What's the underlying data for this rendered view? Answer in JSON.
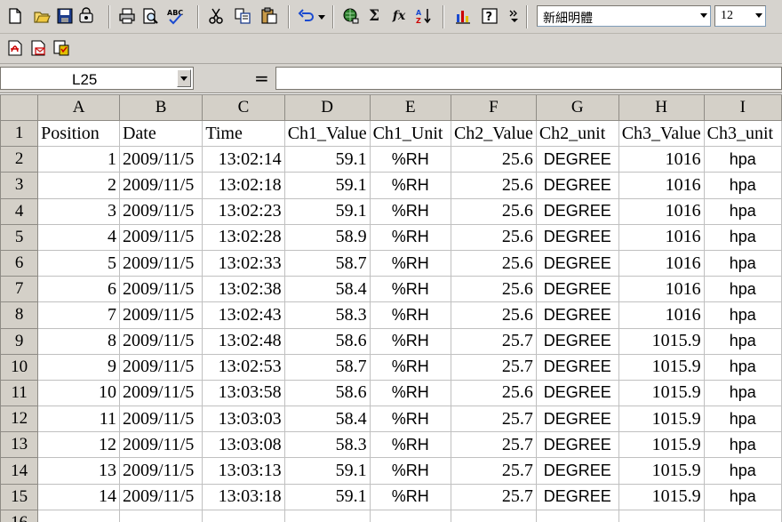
{
  "toolbar": {
    "font_name": "新細明體",
    "font_size": "12",
    "icons": [
      "new-icon",
      "open-icon",
      "save-icon",
      "permission-icon",
      "print-icon",
      "print-preview-icon",
      "spelling-icon",
      "cut-icon",
      "copy-icon",
      "paste-icon",
      "undo-icon",
      "hyperlink-icon",
      "autosum-icon",
      "function-icon",
      "sort-ascending-icon",
      "chart-wizard-icon",
      "help-icon",
      "more-icon"
    ],
    "glyphs": {
      "autosum": "Σ",
      "function": "fx"
    }
  },
  "toolbar2": {
    "icons": [
      "convert-to-pdf-icon",
      "convert-and-email-icon",
      "pdf-review-icon"
    ]
  },
  "formula_bar": {
    "name_box": "L25",
    "equals": "=",
    "formula": ""
  },
  "sheet": {
    "column_headers": [
      "A",
      "B",
      "C",
      "D",
      "E",
      "F",
      "G",
      "H",
      "I"
    ],
    "rows": [
      {
        "n": "1",
        "cells": [
          "Position",
          "Date",
          "Time",
          "Ch1_Value",
          "Ch1_Unit",
          "Ch2_Value",
          "Ch2_unit",
          "Ch3_Value",
          "Ch3_unit"
        ]
      },
      {
        "n": "2",
        "cells": [
          "1",
          "2009/11/5",
          "13:02:14",
          "59.1",
          "%RH",
          "25.6",
          "DEGREE",
          "1016",
          "hpa"
        ]
      },
      {
        "n": "3",
        "cells": [
          "2",
          "2009/11/5",
          "13:02:18",
          "59.1",
          "%RH",
          "25.6",
          "DEGREE",
          "1016",
          "hpa"
        ]
      },
      {
        "n": "4",
        "cells": [
          "3",
          "2009/11/5",
          "13:02:23",
          "59.1",
          "%RH",
          "25.6",
          "DEGREE",
          "1016",
          "hpa"
        ]
      },
      {
        "n": "5",
        "cells": [
          "4",
          "2009/11/5",
          "13:02:28",
          "58.9",
          "%RH",
          "25.6",
          "DEGREE",
          "1016",
          "hpa"
        ]
      },
      {
        "n": "6",
        "cells": [
          "5",
          "2009/11/5",
          "13:02:33",
          "58.7",
          "%RH",
          "25.6",
          "DEGREE",
          "1016",
          "hpa"
        ]
      },
      {
        "n": "7",
        "cells": [
          "6",
          "2009/11/5",
          "13:02:38",
          "58.4",
          "%RH",
          "25.6",
          "DEGREE",
          "1016",
          "hpa"
        ]
      },
      {
        "n": "8",
        "cells": [
          "7",
          "2009/11/5",
          "13:02:43",
          "58.3",
          "%RH",
          "25.6",
          "DEGREE",
          "1016",
          "hpa"
        ]
      },
      {
        "n": "9",
        "cells": [
          "8",
          "2009/11/5",
          "13:02:48",
          "58.6",
          "%RH",
          "25.7",
          "DEGREE",
          "1015.9",
          "hpa"
        ]
      },
      {
        "n": "10",
        "cells": [
          "9",
          "2009/11/5",
          "13:02:53",
          "58.7",
          "%RH",
          "25.7",
          "DEGREE",
          "1015.9",
          "hpa"
        ]
      },
      {
        "n": "11",
        "cells": [
          "10",
          "2009/11/5",
          "13:03:58",
          "58.6",
          "%RH",
          "25.6",
          "DEGREE",
          "1015.9",
          "hpa"
        ]
      },
      {
        "n": "12",
        "cells": [
          "11",
          "2009/11/5",
          "13:03:03",
          "58.4",
          "%RH",
          "25.7",
          "DEGREE",
          "1015.9",
          "hpa"
        ]
      },
      {
        "n": "13",
        "cells": [
          "12",
          "2009/11/5",
          "13:03:08",
          "58.3",
          "%RH",
          "25.7",
          "DEGREE",
          "1015.9",
          "hpa"
        ]
      },
      {
        "n": "14",
        "cells": [
          "13",
          "2009/11/5",
          "13:03:13",
          "59.1",
          "%RH",
          "25.7",
          "DEGREE",
          "1015.9",
          "hpa"
        ]
      },
      {
        "n": "15",
        "cells": [
          "14",
          "2009/11/5",
          "13:03:18",
          "59.1",
          "%RH",
          "25.7",
          "DEGREE",
          "1015.9",
          "hpa"
        ]
      },
      {
        "n": "16",
        "cells": [
          "",
          "",
          "",
          "",
          "",
          "",
          "",
          "",
          ""
        ]
      }
    ]
  }
}
